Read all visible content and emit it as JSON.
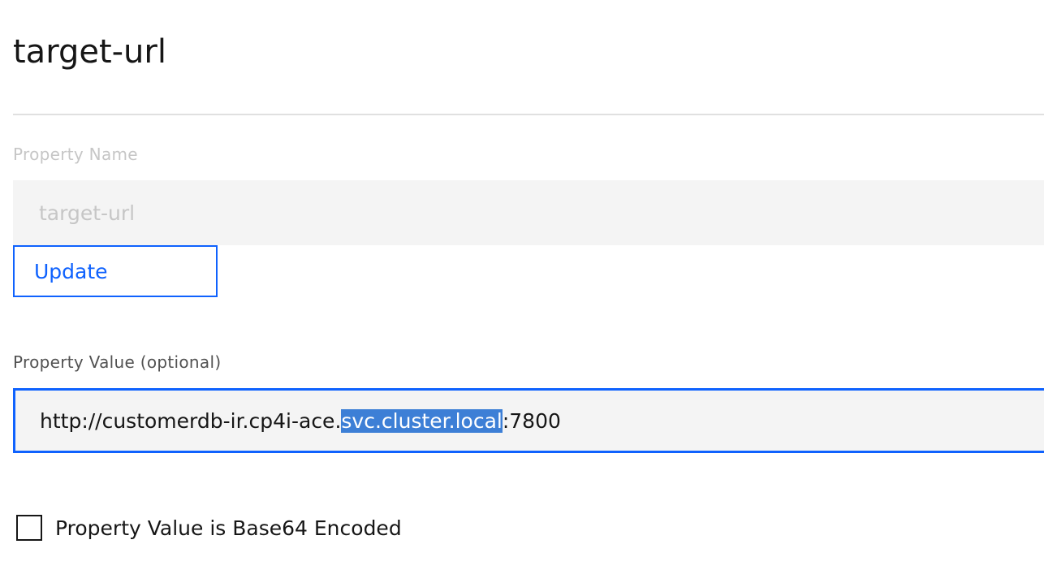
{
  "header": {
    "title": "target-url"
  },
  "property_name": {
    "label": "Property Name",
    "value": "target-url",
    "disabled": true
  },
  "update_button": {
    "label": "Update"
  },
  "property_value": {
    "label": "Property Value (optional)",
    "value_prefix": "http://customerdb-ir.cp4i-ace.",
    "value_selected": "svc.cluster.local",
    "value_suffix": ":7800"
  },
  "base64_checkbox": {
    "label": "Property Value is Base64 Encoded",
    "checked": false
  },
  "colors": {
    "accent": "#0f62fe",
    "selection": "#3d7fd6",
    "field_background": "#f4f4f4"
  }
}
